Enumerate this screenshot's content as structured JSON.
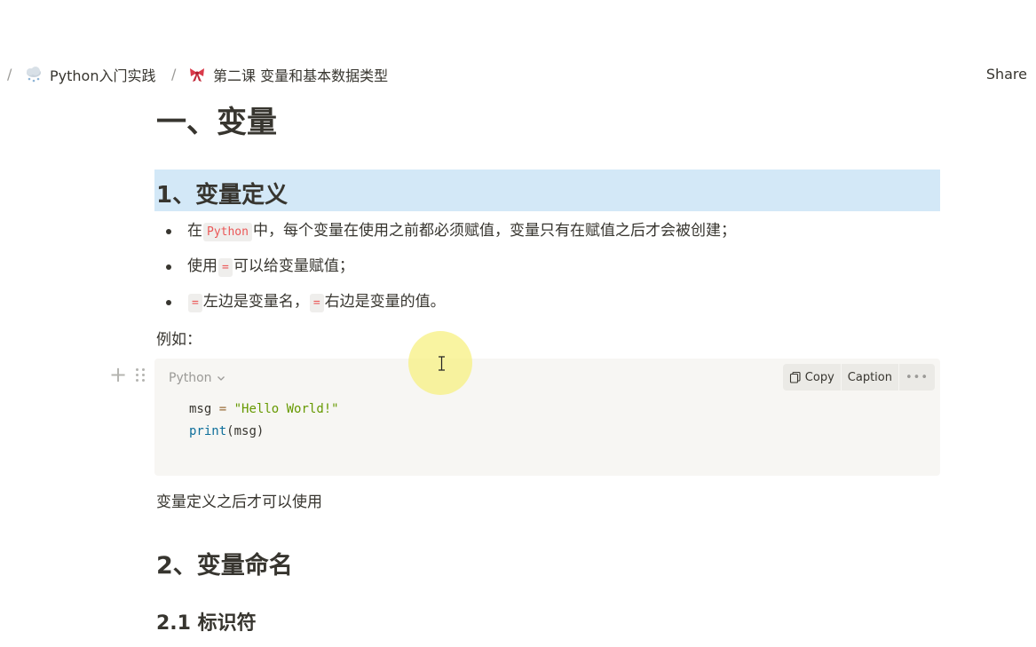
{
  "breadcrumb": {
    "separator": "/",
    "items": [
      {
        "label": "Python入门实践",
        "icon": "snow-cloud-icon"
      },
      {
        "label": "第二课 变量和基本数据类型",
        "icon": "ribbon-bow-icon"
      }
    ]
  },
  "topbar": {
    "share_label": "Share"
  },
  "content": {
    "h1": "一、变量",
    "h2_definition": "1、变量定义",
    "bullets": [
      {
        "before": "在",
        "code": "Python",
        "after": "中，每个变量在使用之前都必须赋值，变量只有在赋值之后才会被创建；"
      },
      {
        "before": "使用",
        "code": "=",
        "after": "可以给变量赋值；"
      },
      {
        "code1": "=",
        "mid": "左边是变量名，",
        "code2": "=",
        "after": "右边是变量的值。"
      }
    ],
    "example_label": "例如：",
    "codeblock": {
      "language": "Python",
      "copy_label": "Copy",
      "caption_label": "Caption",
      "more_label": "•••",
      "line1": {
        "ident": "msg",
        "op": "=",
        "string": "\"Hello World!\""
      },
      "line2": {
        "fn": "print",
        "args": "(msg)"
      }
    },
    "after_code": "变量定义之后才可以使用",
    "h2_naming": "2、变量命名",
    "h3_identifier": "2.1 标识符"
  },
  "colors": {
    "heading_highlight": "#d3e8f7",
    "inline_code": "#eb5757",
    "code_string": "#669900",
    "code_function": "#0f6f9b",
    "cursor_highlight": "#f7f082"
  }
}
